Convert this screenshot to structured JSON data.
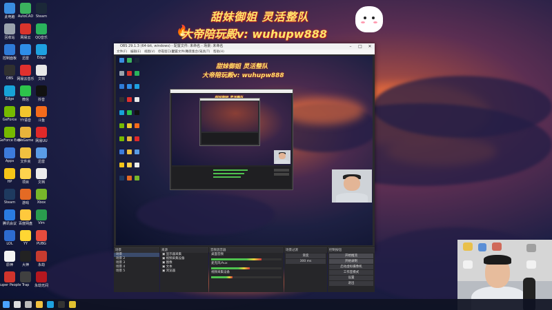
{
  "banner": {
    "line1": "甜妹御姐 灵活整队",
    "line2": "大帝陪玩殿v: wuhupw888"
  },
  "desktop_icons": [
    {
      "label": "此电脑",
      "color": "#3a8de0"
    },
    {
      "label": "AutoCAD",
      "color": "#3bb15e"
    },
    {
      "label": "Steam",
      "color": "#1b2838"
    },
    {
      "label": "回收站",
      "color": "#9aa3ad"
    },
    {
      "label": "网易云",
      "color": "#d8342c"
    },
    {
      "label": "QQ音乐",
      "color": "#2ab35c"
    },
    {
      "label": "控制面板",
      "color": "#2f7bd8"
    },
    {
      "label": "迅雷",
      "color": "#2e8ee8"
    },
    {
      "label": "Edge",
      "color": "#1ea1e0"
    },
    {
      "label": "OBS",
      "color": "#303030"
    },
    {
      "label": "网易云音乐",
      "color": "#e0302e"
    },
    {
      "label": "文档",
      "color": "#e9e9e9"
    },
    {
      "label": "Edge",
      "color": "#17a2d8"
    },
    {
      "label": "微信",
      "color": "#2dc34b"
    },
    {
      "label": "抖音",
      "color": "#111111"
    },
    {
      "label": "GeForce",
      "color": "#76b900"
    },
    {
      "label": "YY语音",
      "color": "#f2c62d"
    },
    {
      "label": "斗鱼",
      "color": "#f56b1b"
    },
    {
      "label": "GeForce Exp",
      "color": "#76b900"
    },
    {
      "label": "WeGame",
      "color": "#e8b33b"
    },
    {
      "label": "网易UU",
      "color": "#e02929"
    },
    {
      "label": "Apps",
      "color": "#3d7bdb"
    },
    {
      "label": "文件夹",
      "color": "#f0c040"
    },
    {
      "label": "迅雷",
      "color": "#5a9ce6"
    },
    {
      "label": "HP",
      "color": "#f5c518"
    },
    {
      "label": "项目",
      "color": "#ffd34e"
    },
    {
      "label": "文档",
      "color": "#ececec"
    },
    {
      "label": "Steam",
      "color": "#1e3a5f"
    },
    {
      "label": "游戏",
      "color": "#e46a24"
    },
    {
      "label": "Xbox",
      "color": "#78b72a"
    },
    {
      "label": "腾讯会议",
      "color": "#2a7be0"
    },
    {
      "label": "百度网盘",
      "color": "#ffc93d"
    },
    {
      "label": "Vim",
      "color": "#2a9b4e"
    },
    {
      "label": "LOL",
      "color": "#2d6bcf"
    },
    {
      "label": "YY",
      "color": "#ffd633"
    },
    {
      "label": "PUBG",
      "color": "#e84c3d"
    },
    {
      "label": "原神",
      "color": "#f3f3f3"
    },
    {
      "label": "大神",
      "color": "#222222"
    },
    {
      "label": "永劫",
      "color": "#c73b2f"
    },
    {
      "label": "Super People",
      "color": "#d0342c"
    },
    {
      "label": "Trap",
      "color": "#404040"
    },
    {
      "label": "永劫无间",
      "color": "#b5171f"
    }
  ],
  "obs": {
    "title": "OBS 29.1.3 (64-bit, windows) - 配置文件: 未命名 - 场景: 未命名",
    "menu": [
      "文件(F)",
      "编辑(E)",
      "视图(V)",
      "停靠窗口(D)",
      "配置文件(P)",
      "场景集合(S)",
      "工具(T)",
      "帮助(H)"
    ],
    "dock_labels": [
      "场景",
      "来源",
      "音频混音器",
      "场景过渡",
      "控制按钮"
    ],
    "scenes": [
      "场景",
      "场景 2",
      "场景 3",
      "场景 4",
      "场景 5"
    ],
    "sources": [
      "显示器采集",
      "视频采集设备",
      "图像",
      "文本",
      "浏览器"
    ],
    "mixer": [
      {
        "name": "桌面音频",
        "level": 0.72
      },
      {
        "name": "麦克风/Aux",
        "level": 0.55
      },
      {
        "name": "视频采集设备",
        "level": 0.3
      }
    ],
    "transition": {
      "type": "渐变",
      "duration": "300 ms"
    },
    "controls": [
      "开始推流",
      "开始录制",
      "启动虚拟摄像机",
      "工作室模式",
      "设置",
      "退出"
    ]
  },
  "taskbar": {
    "items": [
      "start",
      "search",
      "taskview",
      "explorer",
      "edge",
      "obs",
      "chrome"
    ]
  }
}
